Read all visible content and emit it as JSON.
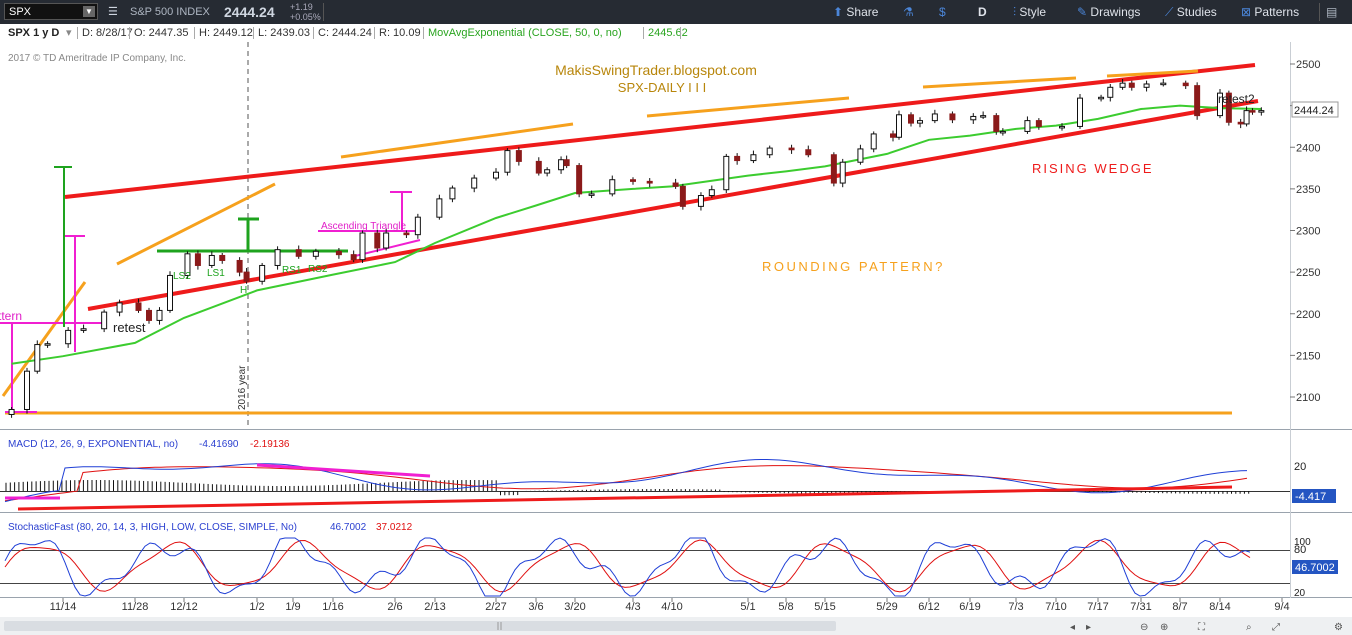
{
  "toolbar": {
    "symbol": "SPX",
    "name": "S&P 500 INDEX",
    "last": "2444.24",
    "change_abs": "+1.19",
    "change_pct": "+0.05%",
    "share": "Share",
    "period": "D",
    "style": "Style",
    "drawings": "Drawings",
    "studies": "Studies",
    "patterns": "Patterns"
  },
  "infobar": {
    "title": "SPX 1 y D",
    "date": "D: 8/28/17",
    "open": "O: 2447.35",
    "high": "H: 2449.12",
    "low": "L: 2439.03",
    "close": "C: 2444.24",
    "range": "R: 10.09",
    "study_label": "MovAvgExponential (CLOSE, 50, 0, no)",
    "study_value": "2445.62",
    "study_color": "#3ccc2f"
  },
  "copyright": "2017 © TD Ameritrade IP Company, Inc.",
  "annotations": {
    "blog": "MakisSwingTrader.blogspot.com",
    "subtitle": "SPX-DAILY  I I I",
    "rising_wedge": "RISING  WEDGE",
    "rounding": "ROUNDING   PATTERN?",
    "retest1": "retest",
    "retest2": "retest2",
    "ascending": "Ascending Triangle",
    "pattern": "ttern",
    "year": "2016 year",
    "ls2": "LS2",
    "ls1": "LS1",
    "h": "H",
    "rs1": "RS1",
    "rs2": "RS2"
  },
  "macd_header": {
    "label": "MACD (12, 26, 9, EXPONENTIAL, no)",
    "v1": "-4.41690",
    "v2": "-2.19136"
  },
  "stoch_header": {
    "label": "StochasticFast (80, 20, 14, 3, HIGH, LOW, CLOSE, SIMPLE, No)",
    "v1": "46.7002",
    "v2": "37.0212"
  },
  "colors": {
    "accent": "#2a64c8",
    "price_tag": "#2455c2",
    "ma": "#3ccc2f",
    "wedge": "#ee1b1b",
    "orange": "#f6a11d",
    "magenta": "#f01fd1",
    "green_neck": "#1ea31e"
  },
  "chart_data": [
    {
      "type": "candlestick",
      "title": "SPX-DAILY",
      "x_ticks": [
        "11/14",
        "11/28",
        "12/12",
        "1/2",
        "1/9",
        "1/16",
        "2/6",
        "2/13",
        "2/27",
        "3/6",
        "3/20",
        "4/3",
        "4/10",
        "5/1",
        "5/8",
        "5/15",
        "5/29",
        "6/12",
        "6/19",
        "7/3",
        "7/10",
        "7/17",
        "7/31",
        "8/7",
        "8/14",
        "9/4"
      ],
      "y_ticks": [
        2100,
        2150,
        2200,
        2250,
        2300,
        2350,
        2400,
        2450,
        2500
      ],
      "ylim": [
        2075,
        2520
      ],
      "last_price": "2444.24",
      "series": [
        {
          "name": "SPX close (approx)",
          "points": [
            [
              "11/4",
              2085
            ],
            [
              "11/7",
              2131
            ],
            [
              "11/9",
              2163
            ],
            [
              "11/11",
              2164
            ],
            [
              "11/15",
              2180
            ],
            [
              "11/18",
              2182
            ],
            [
              "11/22",
              2202
            ],
            [
              "11/25",
              2213
            ],
            [
              "11/29",
              2204
            ],
            [
              "12/2",
              2192
            ],
            [
              "12/5",
              2204
            ],
            [
              "12/8",
              2246
            ],
            [
              "12/13",
              2272
            ],
            [
              "12/16",
              2258
            ],
            [
              "12/20",
              2270
            ],
            [
              "12/23",
              2264
            ],
            [
              "12/28",
              2250
            ],
            [
              "12/30",
              2239
            ],
            [
              "1/3",
              2258
            ],
            [
              "1/6",
              2277
            ],
            [
              "1/10",
              2269
            ],
            [
              "1/13",
              2275
            ],
            [
              "1/18",
              2271
            ],
            [
              "1/23",
              2265
            ],
            [
              "1/26",
              2297
            ],
            [
              "1/31",
              2279
            ],
            [
              "2/3",
              2297
            ],
            [
              "2/8",
              2295
            ],
            [
              "2/10",
              2316
            ],
            [
              "2/14",
              2338
            ],
            [
              "2/17",
              2351
            ],
            [
              "2/22",
              2363
            ],
            [
              "2/27",
              2370
            ],
            [
              "3/1",
              2396
            ],
            [
              "3/3",
              2383
            ],
            [
              "3/7",
              2369
            ],
            [
              "3/10",
              2373
            ],
            [
              "3/15",
              2385
            ],
            [
              "3/17",
              2378
            ],
            [
              "3/21",
              2344
            ],
            [
              "3/24",
              2344
            ],
            [
              "3/29",
              2361
            ],
            [
              "4/3",
              2359
            ],
            [
              "4/6",
              2357
            ],
            [
              "4/11",
              2353
            ],
            [
              "4/13",
              2329
            ],
            [
              "4/18",
              2342
            ],
            [
              "4/21",
              2349
            ],
            [
              "4/25",
              2389
            ],
            [
              "4/28",
              2384
            ],
            [
              "5/2",
              2391
            ],
            [
              "5/5",
              2399
            ],
            [
              "5/9",
              2397
            ],
            [
              "5/12",
              2391
            ],
            [
              "5/17",
              2357
            ],
            [
              "5/19",
              2382
            ],
            [
              "5/23",
              2398
            ],
            [
              "5/26",
              2416
            ],
            [
              "5/31",
              2412
            ],
            [
              "6/2",
              2439
            ],
            [
              "6/6",
              2429
            ],
            [
              "6/9",
              2432
            ],
            [
              "6/13",
              2440
            ],
            [
              "6/16",
              2433
            ],
            [
              "6/20",
              2437
            ],
            [
              "6/23",
              2438
            ],
            [
              "6/27",
              2419
            ],
            [
              "6/29",
              2419
            ],
            [
              "7/5",
              2432
            ],
            [
              "7/7",
              2425
            ],
            [
              "7/11",
              2425
            ],
            [
              "7/14",
              2459
            ],
            [
              "7/18",
              2460
            ],
            [
              "7/21",
              2472
            ],
            [
              "7/25",
              2477
            ],
            [
              "7/28",
              2472
            ],
            [
              "8/1",
              2476
            ],
            [
              "8/4",
              2477
            ],
            [
              "8/8",
              2474
            ],
            [
              "8/10",
              2438
            ],
            [
              "8/14",
              2465
            ],
            [
              "8/17",
              2430
            ],
            [
              "8/21",
              2428
            ],
            [
              "8/23",
              2444
            ],
            [
              "8/25",
              2443
            ],
            [
              "8/28",
              2444
            ]
          ]
        },
        {
          "name": "MovAvgExponential (CLOSE, 50, 0, no)",
          "points": [
            [
              "11/4",
              2140
            ],
            [
              "11/14",
              2149
            ],
            [
              "11/28",
              2165
            ],
            [
              "12/12",
              2195
            ],
            [
              "1/2",
              2228
            ],
            [
              "1/16",
              2247
            ],
            [
              "2/6",
              2262
            ],
            [
              "2/13",
              2285
            ],
            [
              "2/27",
              2315
            ],
            [
              "3/6",
              2330
            ],
            [
              "3/20",
              2345
            ],
            [
              "4/3",
              2350
            ],
            [
              "4/10",
              2353
            ],
            [
              "5/1",
              2366
            ],
            [
              "5/8",
              2371
            ],
            [
              "5/15",
              2377
            ],
            [
              "5/29",
              2392
            ],
            [
              "6/12",
              2409
            ],
            [
              "6/19",
              2414
            ],
            [
              "7/3",
              2422
            ],
            [
              "7/10",
              2426
            ],
            [
              "7/17",
              2434
            ],
            [
              "7/31",
              2446
            ],
            [
              "8/7",
              2450
            ],
            [
              "8/14",
              2447
            ],
            [
              "8/28",
              2446
            ]
          ]
        }
      ]
    },
    {
      "type": "line",
      "title": "MACD (12, 26, 9, EXPONENTIAL, no)",
      "y_ticks": [
        20
      ],
      "last_value": "-4.417"
    },
    {
      "type": "line",
      "title": "StochasticFast (80, 20, 14, 3, HIGH, LOW, CLOSE, SIMPLE, No)",
      "y_ticks": [
        20,
        80,
        100
      ],
      "last_value": "46.7002"
    }
  ]
}
